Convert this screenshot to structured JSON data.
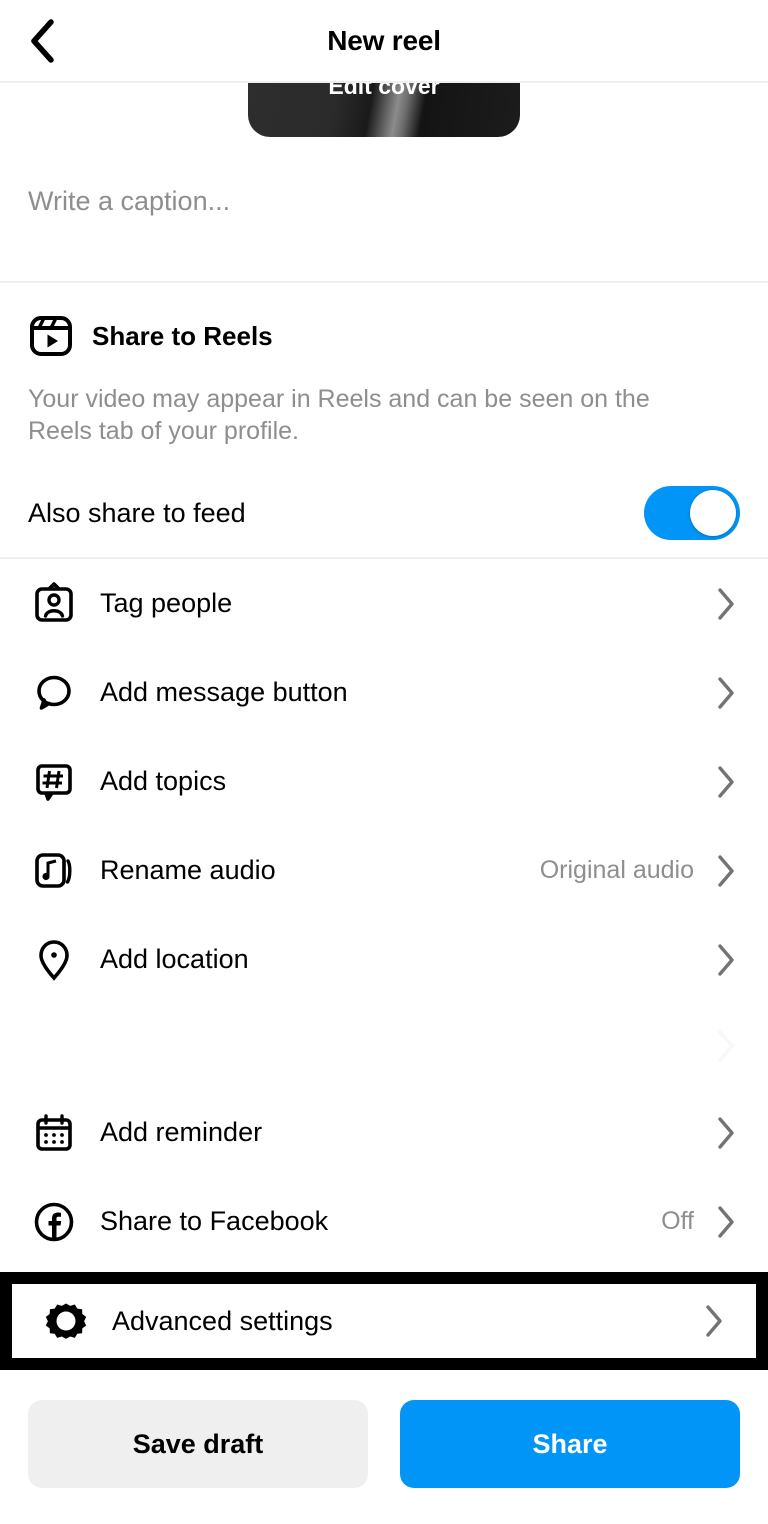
{
  "header": {
    "title": "New reel",
    "back_icon": "chevron-left-icon"
  },
  "cover": {
    "label": "Edit cover"
  },
  "caption": {
    "placeholder": "Write a caption...",
    "value": ""
  },
  "reels_section": {
    "icon": "reels-icon",
    "title": "Share to Reels",
    "description": "Your video may appear in Reels and can be seen on the Reels tab of your profile.",
    "toggle": {
      "label": "Also share to feed",
      "state": "on",
      "color": "#0095F6"
    }
  },
  "menu": {
    "items": [
      {
        "icon": "tag-people-icon",
        "label": "Tag people",
        "value": "",
        "chevron": "chevron-right-icon"
      },
      {
        "icon": "message-bubble-icon",
        "label": "Add message button",
        "value": "",
        "chevron": "chevron-right-icon"
      },
      {
        "icon": "hashtag-icon",
        "label": "Add topics",
        "value": "",
        "chevron": "chevron-right-icon"
      },
      {
        "icon": "music-note-icon",
        "label": "Rename audio",
        "value": "Original audio",
        "chevron": "chevron-right-icon"
      },
      {
        "icon": "location-pin-icon",
        "label": "Add location",
        "value": "",
        "chevron": "chevron-right-icon"
      },
      {
        "icon": "calendar-icon",
        "label": "Add reminder",
        "value": "",
        "chevron": "chevron-right-icon"
      },
      {
        "icon": "facebook-icon",
        "label": "Share to Facebook",
        "value": "Off",
        "chevron": "chevron-right-icon"
      }
    ]
  },
  "highlighted_item": {
    "icon": "gear-icon",
    "label": "Advanced settings",
    "value": "",
    "chevron": "chevron-right-icon",
    "highlight_color": "#000000"
  },
  "actions": {
    "save_draft_label": "Save draft",
    "share_label": "Share",
    "share_color": "#0095F6",
    "draft_color": "#EFEFEF"
  }
}
